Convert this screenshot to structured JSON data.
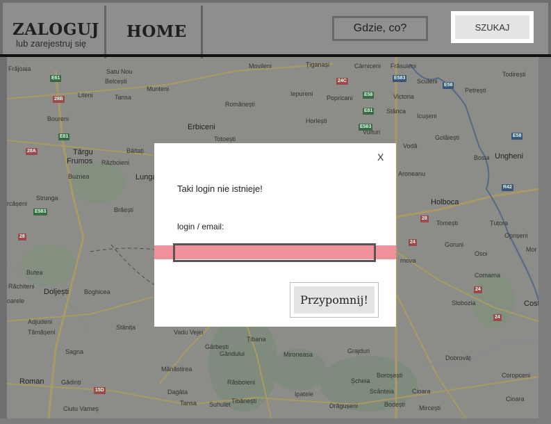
{
  "header": {
    "login_title": "ZALOGUJ",
    "login_subtitle": "lub zarejestruj się",
    "home_label": "HOME",
    "search_placeholder": "Gdzie, co?",
    "search_button": "SZUKAJ"
  },
  "map": {
    "towns": [
      {
        "name": "Frăjoaia",
        "big": false
      },
      {
        "name": "Satu Nou",
        "big": false
      },
      {
        "name": "Belcești",
        "big": false
      },
      {
        "name": "Liteni",
        "big": false
      },
      {
        "name": "Tansa",
        "big": false
      },
      {
        "name": "Munteni",
        "big": false
      },
      {
        "name": "Movileni",
        "big": false
      },
      {
        "name": "Țiganași",
        "big": false
      },
      {
        "name": "Cârniceni",
        "big": false
      },
      {
        "name": "Frăsuleni",
        "big": false
      },
      {
        "name": "Todirești",
        "big": false
      },
      {
        "name": "Popricani",
        "big": false
      },
      {
        "name": "Victoria",
        "big": false
      },
      {
        "name": "Sculeni",
        "big": false
      },
      {
        "name": "Iepureni",
        "big": false
      },
      {
        "name": "Românești",
        "big": false
      },
      {
        "name": "Petrești",
        "big": false
      },
      {
        "name": "Boureni",
        "big": false
      },
      {
        "name": "Horlești",
        "big": false
      },
      {
        "name": "Stânca",
        "big": false
      },
      {
        "name": "Icușeni",
        "big": false
      },
      {
        "name": "Erbiceni",
        "big": false
      },
      {
        "name": "Vulturi",
        "big": false
      },
      {
        "name": "Golăiești",
        "big": false
      },
      {
        "name": "Totoești",
        "big": false
      },
      {
        "name": "Bâltați",
        "big": false
      },
      {
        "name": "Vodă",
        "big": false
      },
      {
        "name": "Târgu",
        "big": true
      },
      {
        "name": "Frumos",
        "big": true
      },
      {
        "name": "Războieni",
        "big": false
      },
      {
        "name": "Bosia",
        "big": false
      },
      {
        "name": "Ungheni",
        "big": true
      },
      {
        "name": "Buznea",
        "big": false
      },
      {
        "name": "Lunga",
        "big": false
      },
      {
        "name": "Aroneanu",
        "big": false
      },
      {
        "name": "Strunga",
        "big": false
      },
      {
        "name": "Holboca",
        "big": true
      },
      {
        "name": "Brăești",
        "big": false
      },
      {
        "name": "rcășeni",
        "big": false
      },
      {
        "name": "Tomești",
        "big": false
      },
      {
        "name": "Țuțora",
        "big": false
      },
      {
        "name": "Oprișeni",
        "big": false
      },
      {
        "name": "Goruni",
        "big": false
      },
      {
        "name": "Butea",
        "big": false
      },
      {
        "name": "Osoi",
        "big": false
      },
      {
        "name": "Mor",
        "big": false
      },
      {
        "name": "rnova",
        "big": false
      },
      {
        "name": "Răchiteni",
        "big": false
      },
      {
        "name": "Doljești",
        "big": false
      },
      {
        "name": "Comarna",
        "big": false
      },
      {
        "name": "Boghicea",
        "big": false
      },
      {
        "name": "oarele",
        "big": false
      },
      {
        "name": "Slobozia",
        "big": false
      },
      {
        "name": "Cost",
        "big": true
      },
      {
        "name": "Adjudeni",
        "big": false
      },
      {
        "name": "Tămășeni",
        "big": false
      },
      {
        "name": "Stânița",
        "big": false
      },
      {
        "name": "Vadu Vejei",
        "big": false
      },
      {
        "name": "Țibana",
        "big": false
      },
      {
        "name": "Gârbești",
        "big": false
      },
      {
        "name": "Sagna",
        "big": false
      },
      {
        "name": "Gândului",
        "big": false
      },
      {
        "name": "Mironeasa",
        "big": false
      },
      {
        "name": "Grajduri",
        "big": false
      },
      {
        "name": "Dobrovăț",
        "big": false
      },
      {
        "name": "Mănăstirea",
        "big": false
      },
      {
        "name": "Roman",
        "big": true
      },
      {
        "name": "Gădinți",
        "big": false
      },
      {
        "name": "Răsboieni",
        "big": false
      },
      {
        "name": "Boroșești",
        "big": false
      },
      {
        "name": "Coropceni",
        "big": false
      },
      {
        "name": "Dagâta",
        "big": false
      },
      {
        "name": "Șcheia",
        "big": false
      },
      {
        "name": "Ipatele",
        "big": false
      },
      {
        "name": "Scânteia",
        "big": false
      },
      {
        "name": "Cioara",
        "big": false
      },
      {
        "name": "Ciutu Vameș",
        "big": false
      },
      {
        "name": "Tansa",
        "big": false
      },
      {
        "name": "Suhulet",
        "big": false
      },
      {
        "name": "Tibănești",
        "big": false
      },
      {
        "name": "Drăgușeni",
        "big": false
      },
      {
        "name": "Bodești",
        "big": false
      },
      {
        "name": "Mircești",
        "big": false
      },
      {
        "name": "Cioara",
        "big": false
      }
    ],
    "road_badges": [
      "E61",
      "28B",
      "E81",
      "28A",
      "E583",
      "E583",
      "24C",
      "E58",
      "E81",
      "E583",
      "E58",
      "E58",
      "R42",
      "28",
      "24",
      "24",
      "15D",
      "28",
      "24"
    ]
  },
  "modal": {
    "close_label": "X",
    "message": "Taki login nie istnieje!",
    "field_label": "login / email:",
    "field_value": "",
    "submit_label": "Przypomnij!"
  }
}
